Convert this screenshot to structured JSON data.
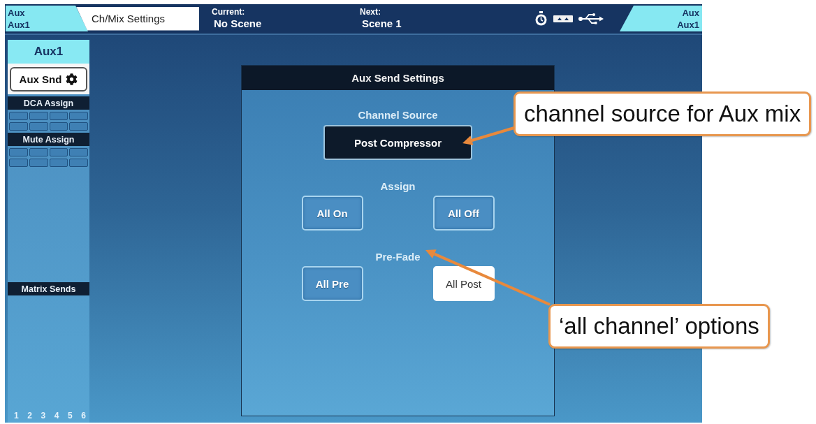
{
  "top_bar": {
    "mix_tab": {
      "type": "Aux",
      "name": "Aux1"
    },
    "settings_tab": {
      "label": "Ch/Mix Settings"
    },
    "scenes": [
      {
        "label": "Current:",
        "value": "No Scene"
      },
      {
        "label": "Next:",
        "value": "Scene 1"
      }
    ],
    "right_mix_tab": {
      "type": "Aux",
      "name": "Aux1"
    }
  },
  "sidebar": {
    "header": "Aux1",
    "aux_send_button": {
      "label": "Aux Snd"
    },
    "assign_groups": [
      {
        "title": "DCA Assign",
        "buttons": [
          {
            "on": false
          },
          {
            "on": false
          },
          {
            "on": false
          },
          {
            "on": false
          },
          {
            "on": false
          },
          {
            "on": false
          },
          {
            "on": false
          },
          {
            "on": false
          }
        ]
      },
      {
        "title": "Mute Assign",
        "buttons": [
          {
            "on": false
          },
          {
            "on": false
          },
          {
            "on": false
          },
          {
            "on": false
          },
          {
            "on": false
          },
          {
            "on": false
          },
          {
            "on": false
          },
          {
            "on": false
          }
        ]
      }
    ],
    "matrix_sends": {
      "title": "Matrix Sends",
      "numbers": [
        "1",
        "2",
        "3",
        "4",
        "5",
        "6"
      ]
    }
  },
  "dialog": {
    "title": "Aux Send Settings",
    "groups": [
      {
        "kind": "dropdown",
        "label": "Channel Source",
        "value": "Post Compressor"
      },
      {
        "kind": "buttons",
        "label": "Assign",
        "buttons": [
          {
            "label": "All On",
            "selected": false
          },
          {
            "label": "All Off",
            "selected": false
          }
        ]
      },
      {
        "kind": "buttons",
        "label": "Pre-Fade",
        "buttons": [
          {
            "label": "All Pre",
            "selected": false
          },
          {
            "label": "All Post",
            "selected": true
          }
        ]
      }
    ]
  },
  "callouts": [
    {
      "text": "channel source for Aux mix"
    },
    {
      "text": "‘all channel’ options"
    }
  ]
}
